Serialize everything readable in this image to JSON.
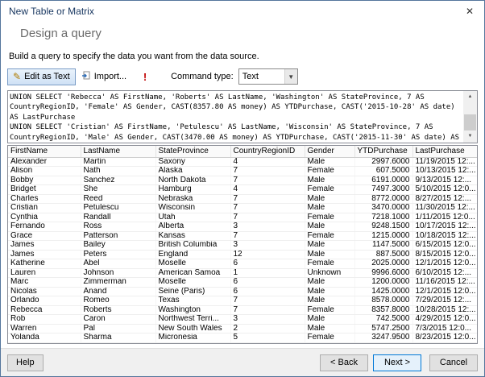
{
  "window": {
    "title": "New Table or Matrix"
  },
  "icons": {
    "close": "✕",
    "edit_pencil": "✎",
    "run_exclamation": "!",
    "dropdown_arrow": "▼",
    "scroll_up": "▲",
    "scroll_down": "▼"
  },
  "wizard": {
    "step_title": "Design a query",
    "instruction": "Build a query to specify the data you want from the data source."
  },
  "toolbar": {
    "edit_as_text_label": "Edit as Text",
    "import_label": "Import...",
    "command_type_label": "Command type:",
    "command_type_value": "Text"
  },
  "query_editor": {
    "lines": [
      "UNION SELECT 'Rebecca' AS FirstName, 'Roberts' AS LastName, 'Washington' AS StateProvince, 7 AS",
      "CountryRegionID, 'Female' AS Gender, CAST(8357.80 AS money) AS YTDPurchase, CAST('2015-10-28' AS date)",
      "AS LastPurchase",
      "UNION SELECT 'Cristian' AS FirstName, 'Petulescu' AS LastName, 'Wisconsin' AS StateProvince, 7 AS",
      "CountryRegionID, 'Male' AS Gender, CAST(3470.00 AS money) AS YTDPurchase, CAST('2015-11-30' AS date) AS"
    ]
  },
  "results_grid": {
    "columns": [
      "FirstName",
      "LastName",
      "StateProvince",
      "CountryRegionID",
      "Gender",
      "YTDPurchase",
      "LastPurchase"
    ],
    "rows": [
      [
        "Alexander",
        "Martin",
        "Saxony",
        "4",
        "Male",
        "2997.6000",
        "11/19/2015 12:..."
      ],
      [
        "Alison",
        "Nath",
        "Alaska",
        "7",
        "Female",
        "607.5000",
        "10/13/2015 12:..."
      ],
      [
        "Bobby",
        "Sanchez",
        "North Dakota",
        "7",
        "Male",
        "6191.0000",
        "9/13/2015 12:..."
      ],
      [
        "Bridget",
        "She",
        "Hamburg",
        "4",
        "Female",
        "7497.3000",
        "5/10/2015 12:0..."
      ],
      [
        "Charles",
        "Reed",
        "Nebraska",
        "7",
        "Male",
        "8772.0000",
        "8/27/2015 12:..."
      ],
      [
        "Cristian",
        "Petulescu",
        "Wisconsin",
        "7",
        "Male",
        "3470.0000",
        "11/30/2015 12:..."
      ],
      [
        "Cynthia",
        "Randall",
        "Utah",
        "7",
        "Female",
        "7218.1000",
        "1/11/2015 12:0..."
      ],
      [
        "Fernando",
        "Ross",
        "Alberta",
        "3",
        "Male",
        "9248.1500",
        "10/17/2015 12:..."
      ],
      [
        "Grace",
        "Patterson",
        "Kansas",
        "7",
        "Female",
        "1215.0000",
        "10/18/2015 12:..."
      ],
      [
        "James",
        "Bailey",
        "British Columbia",
        "3",
        "Male",
        "1147.5000",
        "6/15/2015 12:0..."
      ],
      [
        "James",
        "Peters",
        "England",
        "12",
        "Male",
        "887.5000",
        "8/15/2015 12:0..."
      ],
      [
        "Katherine",
        "Abel",
        "Moselle",
        "6",
        "Female",
        "2025.0000",
        "12/1/2015 12:0..."
      ],
      [
        "Lauren",
        "Johnson",
        "American Samoa",
        "1",
        "Unknown",
        "9996.6000",
        "6/10/2015 12:..."
      ],
      [
        "Marc",
        "Zimmerman",
        "Moselle",
        "6",
        "Male",
        "1200.0000",
        "11/16/2015 12:..."
      ],
      [
        "Nicolas",
        "Anand",
        "Seine (Paris)",
        "6",
        "Male",
        "1425.0000",
        "12/1/2015 12:0..."
      ],
      [
        "Orlando",
        "Romeo",
        "Texas",
        "7",
        "Male",
        "8578.0000",
        "7/29/2015 12:..."
      ],
      [
        "Rebecca",
        "Roberts",
        "Washington",
        "7",
        "Female",
        "8357.8000",
        "10/28/2015 12:..."
      ],
      [
        "Rob",
        "Caron",
        "Northwest Terri...",
        "3",
        "Male",
        "742.5000",
        "4/29/2015 12:0..."
      ],
      [
        "Warren",
        "Pal",
        "New South Wales",
        "2",
        "Male",
        "5747.2500",
        "7/3/2015 12:0..."
      ],
      [
        "Yolanda",
        "Sharma",
        "Micronesia",
        "5",
        "Female",
        "3247.9500",
        "8/23/2015 12:0..."
      ]
    ]
  },
  "footer": {
    "help_label": "Help",
    "back_label": "< Back",
    "next_label": "Next >",
    "cancel_label": "Cancel"
  }
}
